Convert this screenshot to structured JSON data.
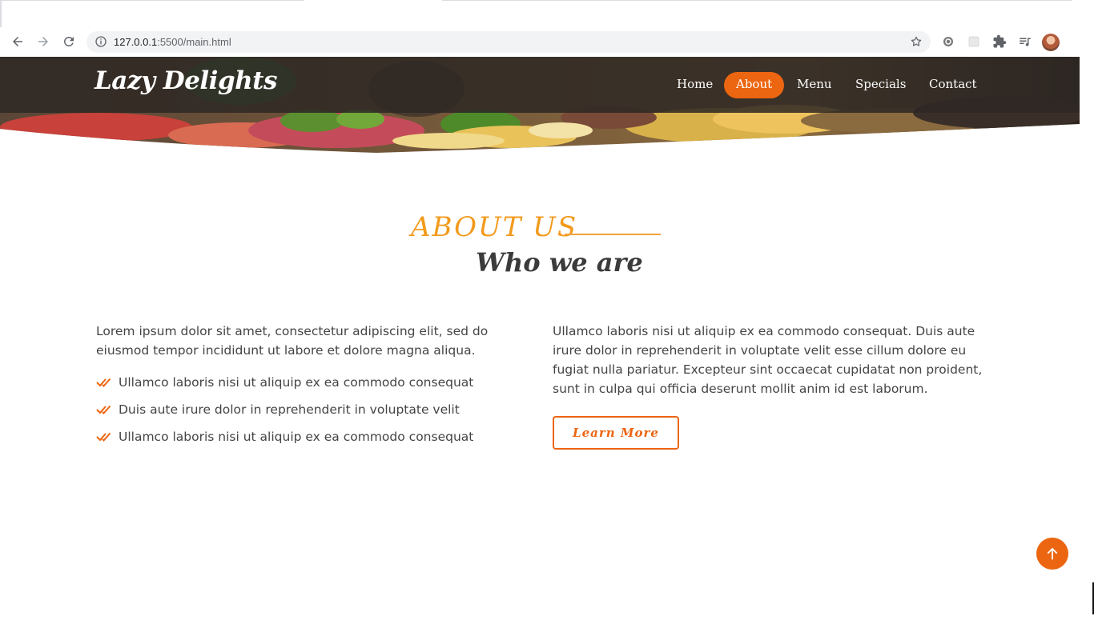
{
  "browser": {
    "url_host": "127.0.0.1",
    "url_rest": ":5500/main.html"
  },
  "site": {
    "logo": "Lazy Delights",
    "nav": [
      {
        "label": "Home",
        "active": false
      },
      {
        "label": "About",
        "active": true
      },
      {
        "label": "Menu",
        "active": false
      },
      {
        "label": "Specials",
        "active": false
      },
      {
        "label": "Contact",
        "active": false
      }
    ]
  },
  "about": {
    "title": "ABOUT US",
    "subtitle": "Who we are",
    "left_paragraph": "Lorem ipsum dolor sit amet, consectetur adipiscing elit, sed do eiusmod tempor incididunt ut labore et dolore magna aliqua.",
    "checklist": [
      "Ullamco laboris nisi ut aliquip ex ea commodo consequat",
      "Duis aute irure dolor in reprehenderit in voluptate velit",
      "Ullamco laboris nisi ut aliquip ex ea commodo consequat"
    ],
    "right_paragraph": "Ullamco laboris nisi ut aliquip ex ea commodo consequat. Duis aute irure dolor in reprehenderit in voluptate velit esse cillum dolore eu fugiat nulla pariatur. Excepteur sint occaecat cupidatat non proident, sunt in culpa qui officia deserunt mollit anim id est laborum.",
    "button_label": "Learn More"
  },
  "icons": {
    "back": "arrow-left-icon",
    "forward": "arrow-right-icon",
    "reload": "reload-icon",
    "info": "info-icon",
    "bookmark": "star-icon",
    "extensions": "puzzle-icon",
    "media": "playlist-icon",
    "check": "double-check-icon",
    "back_to_top": "arrow-up-icon"
  },
  "colors": {
    "accent": "#ec6510",
    "title": "#f29a1c",
    "text": "#444444",
    "header_overlay": "#2d2824"
  }
}
